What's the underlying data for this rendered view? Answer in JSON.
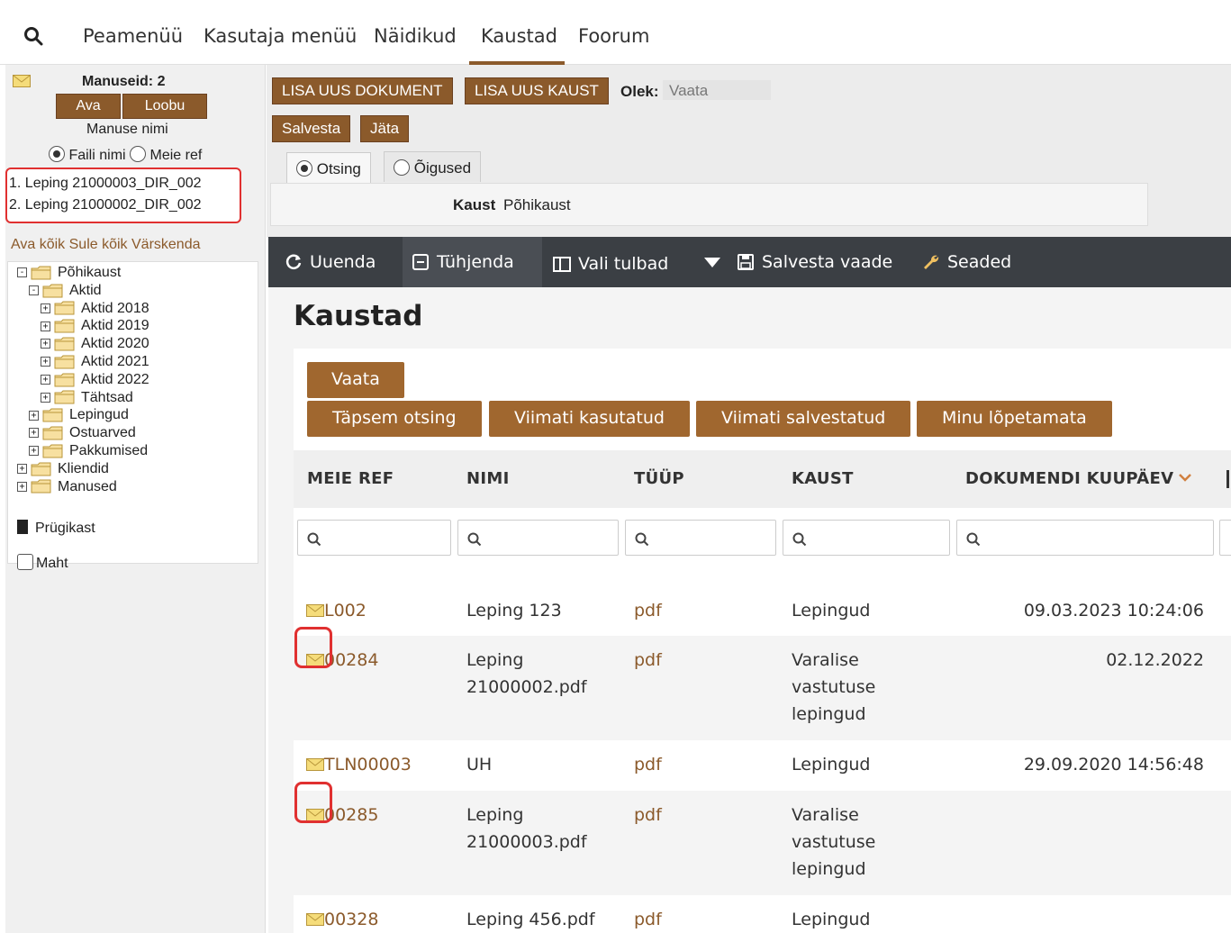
{
  "nav": {
    "items": [
      "Peamenüü",
      "Kasutaja menüü",
      "Näidikud",
      "Kaustad",
      "Foorum"
    ]
  },
  "left": {
    "attachments_label": "Manuseid: 2",
    "open_btn": "Ava",
    "cancel_btn": "Loobu",
    "attach_name_label": "Manuse nimi",
    "radio_filename": "Faili nimi",
    "radio_ourref": "Meie ref",
    "attachments": [
      "1. Leping 21000003_DIR_002",
      "2. Leping 21000002_DIR_002"
    ],
    "tree_actions": "Ava kõik Sule kõik Värskenda",
    "tree": [
      {
        "label": "Põhikaust",
        "pm": "-",
        "indent": 0
      },
      {
        "label": "Aktid",
        "pm": "-",
        "indent": 1
      },
      {
        "label": "Aktid 2018",
        "pm": "+",
        "indent": 2
      },
      {
        "label": "Aktid 2019",
        "pm": "+",
        "indent": 2
      },
      {
        "label": "Aktid 2020",
        "pm": "+",
        "indent": 2
      },
      {
        "label": "Aktid 2021",
        "pm": "+",
        "indent": 2
      },
      {
        "label": "Aktid 2022",
        "pm": "+",
        "indent": 2
      },
      {
        "label": "Tähtsad",
        "pm": "+",
        "indent": 2
      },
      {
        "label": "Lepingud",
        "pm": "+",
        "indent": 1
      },
      {
        "label": "Ostuarved",
        "pm": "+",
        "indent": 1
      },
      {
        "label": "Pakkumised",
        "pm": "+",
        "indent": 1
      },
      {
        "label": "Kliendid",
        "pm": "+",
        "indent": 0
      },
      {
        "label": "Manused",
        "pm": "+",
        "indent": 0
      }
    ],
    "trash": "Prügikast",
    "size": "Maht"
  },
  "form": {
    "add_doc": "LISA UUS DOKUMENT",
    "add_folder": "LISA UUS KAUST",
    "state_label": "Olek:",
    "state_value": "Vaata",
    "save": "Salvesta",
    "cancel": "Jäta",
    "tab_search": "Otsing",
    "tab_rights": "Õigused",
    "folder_label": "Kaust",
    "folder_value": "Põhikaust"
  },
  "toolbar": {
    "refresh": "Uuenda",
    "clear": "Tühjenda",
    "columns": "Vali tulbad",
    "save_view": "Salvesta vaade",
    "settings": "Seaded"
  },
  "main": {
    "title": "Kaustad",
    "btn_view": "Vaata",
    "btn_adv": "Täpsem otsing",
    "btn_recent_used": "Viimati kasutatud",
    "btn_recent_saved": "Viimati salvestatud",
    "btn_unfinished": "Minu lõpetamata",
    "columns": [
      "MEIE REF",
      "NIMI",
      "TÜÜP",
      "KAUST",
      "DOKUMENDI KUUPÄEV"
    ],
    "rows": [
      {
        "ref": "L002",
        "name": [
          "Leping 123"
        ],
        "type": "pdf",
        "folder": [
          "Lepingud"
        ],
        "date": "09.03.2023 10:24:06"
      },
      {
        "ref": "00284",
        "name": [
          "Leping",
          "21000002.pdf"
        ],
        "type": "pdf",
        "folder": [
          "Varalise",
          "vastutuse",
          "lepingud"
        ],
        "date": "02.12.2022"
      },
      {
        "ref": "TLN00003",
        "name": [
          "UH"
        ],
        "type": "pdf",
        "folder": [
          "Lepingud"
        ],
        "date": "29.09.2020 14:56:48"
      },
      {
        "ref": "00285",
        "name": [
          "Leping",
          "21000003.pdf"
        ],
        "type": "pdf",
        "folder": [
          "Varalise",
          "vastutuse",
          "lepingud"
        ],
        "date": ""
      },
      {
        "ref": "00328",
        "name": [
          "Leping 456.pdf"
        ],
        "type": "pdf",
        "folder": [
          "Lepingud"
        ],
        "date": ""
      }
    ]
  },
  "colors": {
    "brand": "#8b5a2b",
    "toolbar": "#3b3f44",
    "highlight": "#e03030"
  }
}
